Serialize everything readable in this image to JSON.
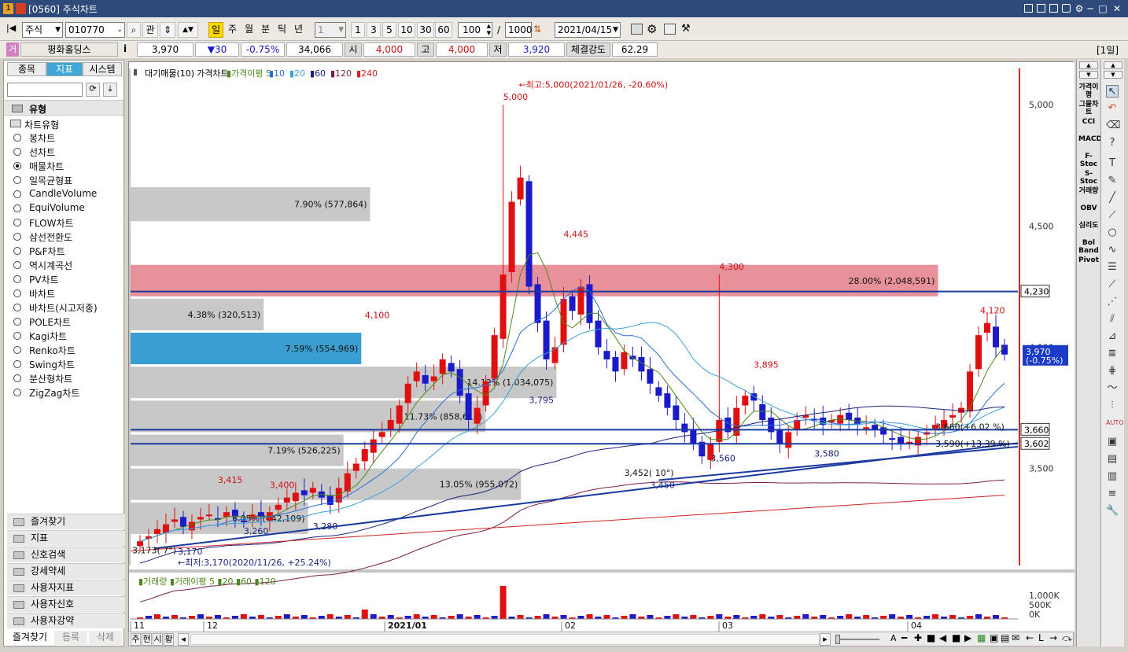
{
  "window": {
    "title": "[0560] 주식차트",
    "number_badge": "1",
    "title_icon": "app-icon"
  },
  "toolbar": {
    "market": "주식",
    "code": "010770",
    "btn_gwan": "관",
    "periods": [
      "일",
      "주",
      "월",
      "분",
      "틱",
      "년"
    ],
    "interval_select": "1",
    "quick_intervals": [
      "1",
      "3",
      "5",
      "10",
      "30",
      "60"
    ],
    "zoom": "100",
    "slash": "/",
    "count": "1000",
    "date": "2021/04/15"
  },
  "quote": {
    "badge": "거",
    "name": "평화홀딩스",
    "info": "i",
    "last": "3,970",
    "change": "▼30",
    "change_pct": "-0.75%",
    "volume": "34,066",
    "open_label": "시",
    "open": "4,000",
    "high_label": "고",
    "high": "4,000",
    "low_label": "저",
    "low": "3,920",
    "strength_label": "체결강도",
    "strength": "62.29",
    "period_tag": "[1일]"
  },
  "left": {
    "tabs": [
      "종목",
      "지표",
      "시스템"
    ],
    "section": "유형",
    "subsection": "차트유형",
    "chart_types": [
      "봉차트",
      "선차트",
      "매물차트",
      "일목균형표",
      "CandleVolume",
      "EquiVolume",
      "FLOW차트",
      "삼선전환도",
      "P&F차트",
      "역시계곡선",
      "PV차트",
      "바차트",
      "바차트(시고저종)",
      "POLE차트",
      "Kagi차트",
      "Renko차트",
      "Swing차트",
      "분산형차트",
      "ZigZag차트"
    ],
    "selected_index": 2,
    "groups": [
      "즐겨찾기",
      "지표",
      "신호검색",
      "강세약세",
      "사용자지표",
      "사용자신호",
      "사용자강약"
    ],
    "bottom_tabs": [
      "즐겨찾기",
      "등록",
      "삭제"
    ]
  },
  "chart_data": {
    "type": "candlestick",
    "legend": "대기매물(10) ▮가격차트 ▮가격이평 5 ▮10 ▮20 ▮60 ▮120 ▮240",
    "legend_parts": [
      {
        "text": "대기매물(10)",
        "color": "#000000"
      },
      {
        "text": "가격차트",
        "color": "#000000"
      },
      {
        "text": "가격이평 5",
        "color": "#4b8a1a"
      },
      {
        "text": "10",
        "color": "#2a6fd8"
      },
      {
        "text": "20",
        "color": "#3aa0d8"
      },
      {
        "text": "60",
        "color": "#1a237e"
      },
      {
        "text": "120",
        "color": "#7a1f4a"
      },
      {
        "text": "240",
        "color": "#d22222"
      }
    ],
    "price_axis": [
      "5,000",
      "4,500",
      "4,000",
      "3,500"
    ],
    "ylim": [
      3100,
      5150
    ],
    "date_axis": [
      "11",
      "12",
      "2021/01",
      "02",
      "03",
      "04"
    ],
    "last_price": "3,970",
    "last_change": "(-0.75%)",
    "level_labels": [
      "4,230",
      "3,660",
      "3,602"
    ],
    "volume_profile": [
      {
        "label": "7.90% (577,864)",
        "from": 4520,
        "to": 4660,
        "pct": 0.27,
        "highlight": "none"
      },
      {
        "label": "28.00% (2,048,591)",
        "from": 4210,
        "to": 4340,
        "pct": 0.91,
        "highlight": "pink"
      },
      {
        "label": "4.38% (320,513)",
        "from": 4070,
        "to": 4200,
        "pct": 0.15,
        "highlight": "none"
      },
      {
        "label": "7.59% (554,969)",
        "from": 3930,
        "to": 4060,
        "pct": 0.26,
        "highlight": "blue"
      },
      {
        "label": "14.12% (1,034,075)",
        "from": 3790,
        "to": 3920,
        "pct": 0.48,
        "highlight": "none"
      },
      {
        "label": "11.73% (858,613)",
        "from": 3650,
        "to": 3780,
        "pct": 0.4,
        "highlight": "none"
      },
      {
        "label": "7.19% (526,225)",
        "from": 3510,
        "to": 3640,
        "pct": 0.24,
        "highlight": "none"
      },
      {
        "label": "13.05% (955,072)",
        "from": 3370,
        "to": 3500,
        "pct": 0.44,
        "highlight": "none"
      },
      {
        "label": "6.05% (442,109)",
        "from": 3230,
        "to": 3360,
        "pct": 0.2,
        "highlight": "none"
      }
    ],
    "annotations": [
      {
        "text": "←최고:5,000(2021/01/26, -20.60%)",
        "color": "red"
      },
      {
        "text": "5,000",
        "color": "red"
      },
      {
        "text": "4,445",
        "color": "red"
      },
      {
        "text": "4,300",
        "color": "red"
      },
      {
        "text": "4,100",
        "color": "red"
      },
      {
        "text": "4,120",
        "color": "red"
      },
      {
        "text": "3,895",
        "color": "red"
      },
      {
        "text": "3,415",
        "color": "red"
      },
      {
        "text": "3,400",
        "color": "red"
      },
      {
        "text": "3,795",
        "color": "navy"
      },
      {
        "text": "3,260",
        "color": "navy"
      },
      {
        "text": "3,280",
        "color": "navy"
      },
      {
        "text": "3,450",
        "color": "navy"
      },
      {
        "text": "3,560",
        "color": "navy"
      },
      {
        "text": "3,580",
        "color": "navy"
      },
      {
        "text": "3,452( 10°)",
        "color": "black"
      },
      {
        "text": "3,173(  7°)",
        "color": "black"
      },
      {
        "text": "3,170",
        "color": "navy"
      },
      {
        "text": "3,660(+6.02 %)",
        "color": "black"
      },
      {
        "text": "3,590(+13.39 %)",
        "color": "black"
      },
      {
        "text": "←최저:3,170(2020/11/26, +25.24%)",
        "color": "navy"
      }
    ],
    "volume_legend": "▮거래량 ▮거래이평 5 ▮20 ▮60 ▮120",
    "volume_axis": [
      "1,000K",
      "500K",
      "0K"
    ]
  },
  "right_indicators": [
    "가격이평",
    "그물차트",
    "CCI",
    "MACD",
    "F-Stoc",
    "S-Stoc",
    "거래량",
    "OBV",
    "심리도",
    "Bol Band",
    "Pivot"
  ],
  "bottom": {
    "tabs": [
      "주",
      "현",
      "시",
      "황"
    ],
    "letter_A": "A"
  },
  "colors": {
    "up": "#e01010",
    "down": "#1a1ac8",
    "accent": "#3fa7d8",
    "title": "#2d4a7a"
  }
}
